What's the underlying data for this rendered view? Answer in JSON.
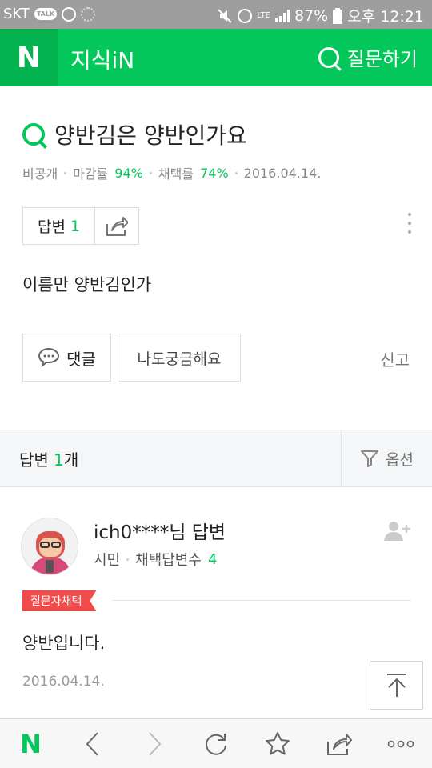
{
  "status_bar": {
    "carrier": "SKT",
    "talk_label": "TALK",
    "network": "LTE",
    "battery": "87%",
    "time": "오후 12:21"
  },
  "header": {
    "logo": "N",
    "title": "지식iN",
    "ask_label": "질문하기"
  },
  "question": {
    "title": "양반김은 양반인가요",
    "author": "비공개",
    "close_rate_label": "마감률",
    "close_rate": "94%",
    "select_rate_label": "채택률",
    "select_rate": "74%",
    "date": "2016.04.14.",
    "answer_label": "답변",
    "answer_count": "1",
    "body": "이름만 양반김인가",
    "comment_label": "댓글",
    "curious_label": "나도궁금해요",
    "report_label": "신고"
  },
  "answers_section": {
    "title_prefix": "답변 ",
    "count": "1",
    "title_suffix": "개",
    "option_label": "옵션"
  },
  "answer": {
    "user": "ich0****님 답변",
    "rank": "시민",
    "selected_count_label": "채택답변수",
    "selected_count": "4",
    "badge": "질문자채택",
    "body": "양반입니다.",
    "date": "2016.04.14."
  },
  "bottom_toolbar": {
    "home_logo": "N"
  },
  "colors": {
    "brand_green": "#03c75a",
    "badge_red": "#f04b4b"
  }
}
